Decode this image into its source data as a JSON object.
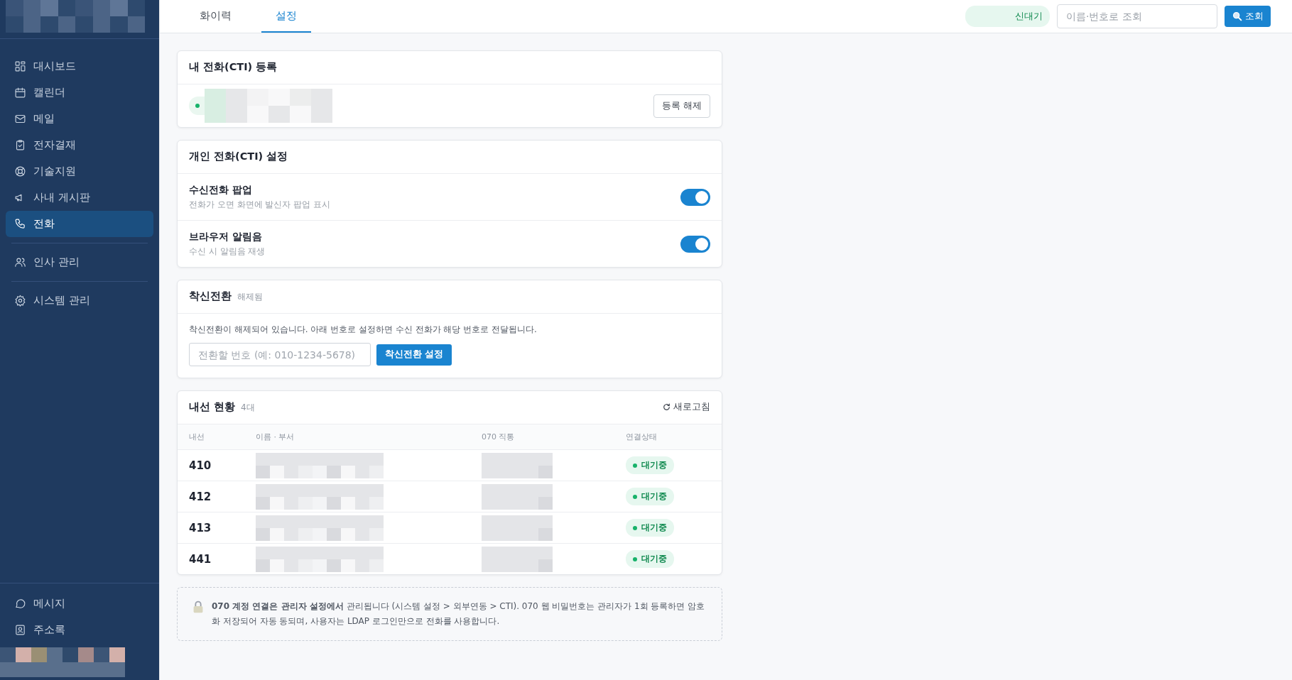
{
  "sidebar": {
    "groups": [
      [
        {
          "label": "대시보드",
          "selected": false
        },
        {
          "label": "캘린더",
          "selected": false
        },
        {
          "label": "메일",
          "selected": false
        },
        {
          "label": "전자결재",
          "selected": false
        },
        {
          "label": "기술지원",
          "selected": false
        },
        {
          "label": "사내 게시판",
          "selected": false
        },
        {
          "label": "전화",
          "selected": true
        }
      ],
      [
        {
          "label": "인사 관리",
          "selected": false
        }
      ],
      [
        {
          "label": "시스템 관리",
          "selected": false
        }
      ]
    ],
    "bottom_items": [
      {
        "label": "메시지",
        "selected": false
      },
      {
        "label": "주소록",
        "selected": false
      }
    ]
  },
  "tabs": [
    {
      "label": "화이력",
      "selected": false
    },
    {
      "label": "설정",
      "selected": true
    }
  ],
  "status_pill": "신대기",
  "search": {
    "placeholder": "이름·번호로 조회"
  },
  "search_button": "조회",
  "registration": {
    "title": "내 전화(CTI) 등록",
    "online": true,
    "button": "등록 해제"
  },
  "personal": {
    "title": "개인 전화(CTI) 설정",
    "settings": [
      {
        "label": "수신전화 팝업",
        "description": "전화가 오면 화면에 발신자 팝업 표시",
        "on": true
      },
      {
        "label": "브라우저 알림음",
        "description": "수신 시 알림음 재생",
        "on": true
      }
    ]
  },
  "forwarding": {
    "title": "착신전환",
    "status": "해제됨",
    "message": "착신전환이 해제되어 있습니다. 아래 번호로 설정하면 수신 전화가 해당 번호로 전달됩니다.",
    "input": {
      "placeholder": "전환할 번호 (예: 010-1234-5678)"
    },
    "button": "착신전환 설정"
  },
  "extensions": {
    "title": "내선 현황",
    "count": "4대",
    "refresh": "새로고침",
    "columns": [
      "내선",
      "이름 · 부서",
      "070 직통",
      "연결상태"
    ],
    "rows": [
      {
        "extension": "410",
        "status": "대기중"
      },
      {
        "extension": "412",
        "status": "대기중"
      },
      {
        "extension": "413",
        "status": "대기중"
      },
      {
        "extension": "441",
        "status": "대기중"
      }
    ]
  },
  "note": "**070 계정 연결은 관리자 설정에서** 관리됩니다 (시스템 설정 > 외부연동 > CTI). 070 웹 비밀번호는 관리자가 1회 등록하면 암호화 저장되어 자동 동되며, 사용자는 LDAP 로그인만으로 전화를 사용합니다."
}
